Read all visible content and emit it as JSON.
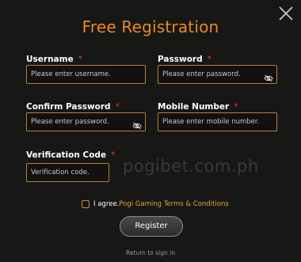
{
  "dialog": {
    "title": "Free Registration",
    "close_icon": "close-icon"
  },
  "form": {
    "username": {
      "label": "Username",
      "required_mark": "*",
      "placeholder": "Please enter username.",
      "value": ""
    },
    "password": {
      "label": "Password",
      "required_mark": "*",
      "placeholder": "Please enter password.",
      "value": "",
      "icon": "eye-slash-icon"
    },
    "confirm_password": {
      "label": "Confirm Password",
      "required_mark": "*",
      "placeholder": "Please enter password.",
      "value": "",
      "icon": "eye-slash-icon"
    },
    "mobile_number": {
      "label": "Mobile Number",
      "required_mark": "*",
      "placeholder": "Please enter mobile number.",
      "value": ""
    },
    "verification_code": {
      "label": "Verification Code",
      "required_mark": "*",
      "placeholder": "Verification code.",
      "value": ""
    }
  },
  "watermark": "pogibet.com.ph",
  "agreement": {
    "checked": false,
    "prefix": "I agree.",
    "link_text": "Pogi Gaming Terms & Conditions"
  },
  "register_button": "Register",
  "return_link": "Return to sign in",
  "colors": {
    "accent": "#ee8a1f",
    "input_border": "#b08433",
    "required": "#e53935",
    "link": "#e6a23c",
    "background": "#171716"
  }
}
